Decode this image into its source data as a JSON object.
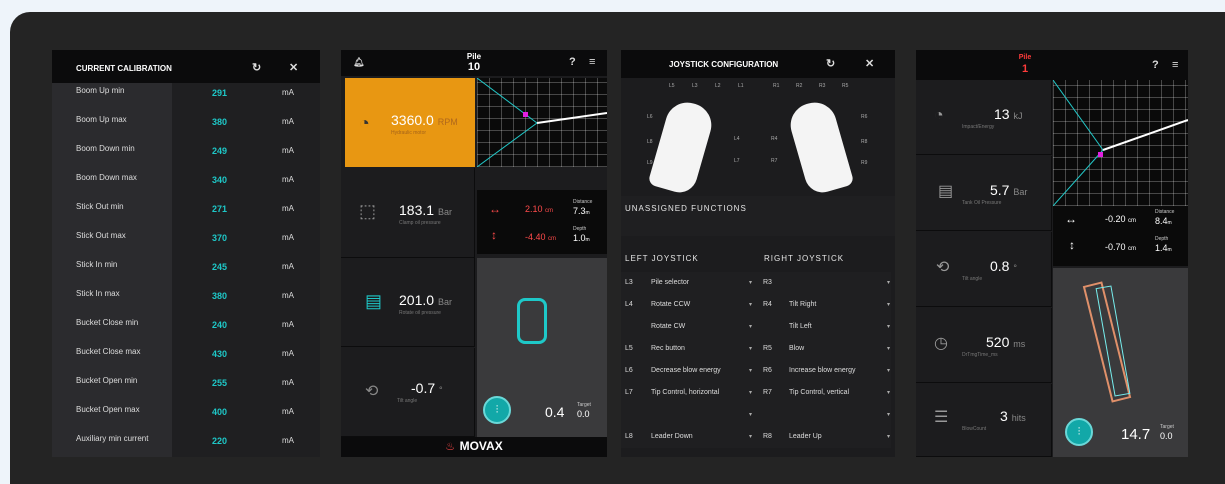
{
  "calibration": {
    "title": "CURRENT CALIBRATION",
    "refresh_icon": "refresh-icon",
    "close_icon": "close-icon",
    "rows": [
      {
        "label": "Boom Up min",
        "value": "291",
        "unit": "mA"
      },
      {
        "label": "Boom Up max",
        "value": "380",
        "unit": "mA"
      },
      {
        "label": "Boom Down min",
        "value": "249",
        "unit": "mA"
      },
      {
        "label": "Boom Down max",
        "value": "340",
        "unit": "mA"
      },
      {
        "label": "Stick Out min",
        "value": "271",
        "unit": "mA"
      },
      {
        "label": "Stick Out max",
        "value": "370",
        "unit": "mA"
      },
      {
        "label": "Stick In min",
        "value": "245",
        "unit": "mA"
      },
      {
        "label": "Stick In max",
        "value": "380",
        "unit": "mA"
      },
      {
        "label": "Bucket Close min",
        "value": "240",
        "unit": "mA"
      },
      {
        "label": "Bucket Close max",
        "value": "430",
        "unit": "mA"
      },
      {
        "label": "Bucket Open min",
        "value": "255",
        "unit": "mA"
      },
      {
        "label": "Bucket Open max",
        "value": "400",
        "unit": "mA"
      },
      {
        "label": "Auxiliary min current",
        "value": "220",
        "unit": "mA"
      }
    ]
  },
  "pile_panel": {
    "pile_label": "Pile",
    "pile_number": "10",
    "rpm": {
      "value": "3360.0",
      "unit": "RPM",
      "sub": "Hydraulic motor"
    },
    "clamp": {
      "value": "183.1",
      "unit": "Bar",
      "sub": "Clamp oil pressure"
    },
    "rotate": {
      "value": "201.0",
      "unit": "Bar",
      "sub": "Rotate oil pressure"
    },
    "tilt": {
      "value": "-0.7",
      "unit": "°",
      "sub": "Tilt angle"
    },
    "horizontal": {
      "value": "2.10",
      "unit": "cm"
    },
    "vertical": {
      "value": "-4.40",
      "unit": "cm"
    },
    "distance": {
      "label": "Distance",
      "value": "7.3",
      "unit": "m"
    },
    "depth": {
      "label": "Depth",
      "value": "1.0",
      "unit": "m"
    },
    "progress": {
      "value": "0.4",
      "target_label": "Target",
      "target": "0.0"
    },
    "logo": "MOVAX"
  },
  "joystick": {
    "title": "JOYSTICK CONFIGURATION",
    "left_top_buttons": [
      "L5",
      "L3",
      "L2",
      "L1"
    ],
    "right_top_buttons": [
      "R1",
      "R2",
      "R3",
      "R5"
    ],
    "left_side_buttons": [
      "L6",
      "L8",
      "L9",
      "L4",
      "L7"
    ],
    "right_side_buttons": [
      "R6",
      "R8",
      "R9",
      "R4",
      "R7"
    ],
    "unassigned_title": "UNASSIGNED FUNCTIONS",
    "left_title": "LEFT JOYSTICK",
    "right_title": "RIGHT JOYSTICK",
    "rows": [
      {
        "lk": "L3",
        "lf": "Pile selector",
        "rk": "R3",
        "rf": ""
      },
      {
        "lk": "L4",
        "lf": "Rotate CCW",
        "rk": "R4",
        "rf": "Tilt Right"
      },
      {
        "lk": "",
        "lf": "Rotate CW",
        "rk": "",
        "rf": "Tilt Left"
      },
      {
        "lk": "L5",
        "lf": "Rec button",
        "rk": "R5",
        "rf": "Blow"
      },
      {
        "lk": "L6",
        "lf": "Decrease blow energy",
        "rk": "R6",
        "rf": "Increase blow energy"
      },
      {
        "lk": "L7",
        "lf": "Tip Control, horizontal",
        "rk": "R7",
        "rf": "Tip Control, vertical"
      },
      {
        "lk": "",
        "lf": "",
        "rk": "",
        "rf": ""
      },
      {
        "lk": "L8",
        "lf": "Leader Down",
        "rk": "R8",
        "rf": "Leader Up"
      }
    ]
  },
  "hammer_panel": {
    "pile_label": "Pile",
    "pile_number": "1",
    "energy": {
      "value": "13",
      "unit": "kJ",
      "sub": "Impact/Energy"
    },
    "tank": {
      "value": "5.7",
      "unit": "Bar",
      "sub": "Tank Oil Pressure"
    },
    "tilt": {
      "value": "0.8",
      "unit": "°",
      "sub": "Tilt angle"
    },
    "time": {
      "value": "520",
      "unit": "ms",
      "sub": "DrTmgTime_ms"
    },
    "blows": {
      "value": "3",
      "unit": "hits",
      "sub": "BlowCount"
    },
    "horizontal": {
      "value": "-0.20",
      "unit": "cm"
    },
    "vertical": {
      "value": "-0.70",
      "unit": "cm"
    },
    "distance": {
      "label": "Distance",
      "value": "8.4",
      "unit": "m"
    },
    "depth": {
      "label": "Depth",
      "value": "1.4",
      "unit": "m"
    },
    "progress": {
      "value": "14.7",
      "target_label": "Target",
      "target": "0.0"
    }
  },
  "colors": {
    "accent_orange": "#e89712",
    "teal": "#1ec8c8",
    "red": "#ff4b4b",
    "magenta": "#e020e0"
  }
}
